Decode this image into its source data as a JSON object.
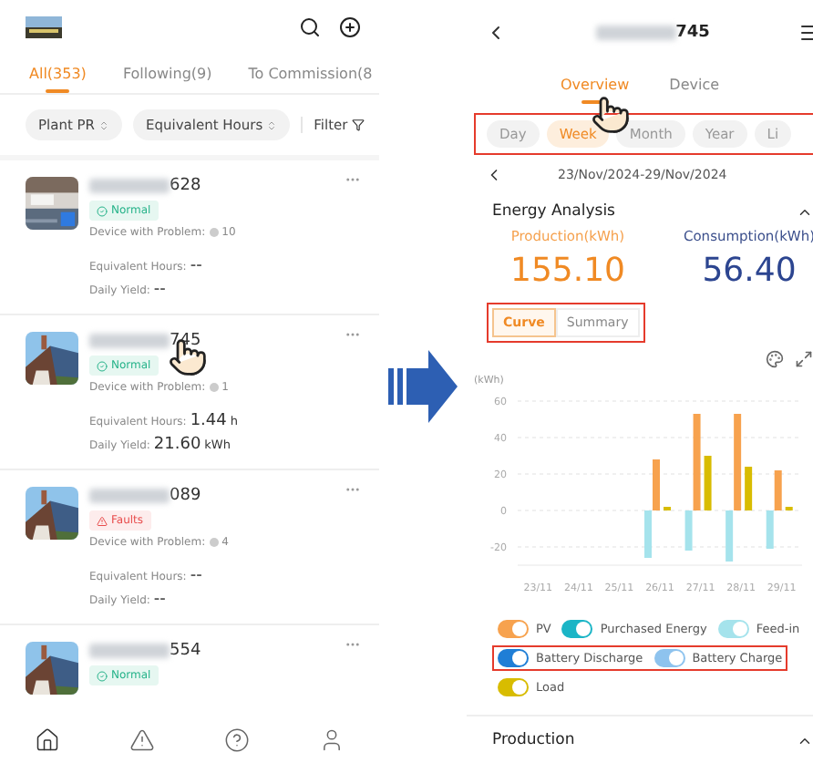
{
  "left_screen": {
    "tabs": [
      {
        "label": "All(353)",
        "selected": true
      },
      {
        "label": "Following(9)",
        "selected": false
      },
      {
        "label": "To Commission(8",
        "selected": false
      }
    ],
    "sort_chips": [
      {
        "label": "Plant PR"
      },
      {
        "label": "Equivalent Hours"
      }
    ],
    "filter": "Filter",
    "plants": [
      {
        "id_suffix": "628",
        "status": "Normal",
        "kind": "normal",
        "problem_label": "Device with Problem:",
        "problem_count": "10",
        "hours_label": "Equivalent Hours:",
        "hours_value": "--",
        "yield_label": "Daily Yield:",
        "yield_value": "--",
        "pointer": false
      },
      {
        "id_suffix": "745",
        "status": "Normal",
        "kind": "normal",
        "problem_label": "Device with Problem:",
        "problem_count": "1",
        "hours_label": "Equivalent Hours:",
        "hours_value": "1.44",
        "hours_unit": "h",
        "yield_label": "Daily Yield:",
        "yield_value": "21.60",
        "yield_unit": "kWh",
        "pointer": true
      },
      {
        "id_suffix": "089",
        "status": "Faults",
        "kind": "fault",
        "problem_label": "Device with Problem:",
        "problem_count": "4",
        "hours_label": "Equivalent Hours:",
        "hours_value": "--",
        "yield_label": "Daily Yield:",
        "yield_value": "--",
        "pointer": false
      },
      {
        "id_suffix": "554",
        "status": "Normal",
        "kind": "normal",
        "pointer": false
      }
    ]
  },
  "right_screen": {
    "title_suffix": "745",
    "tabs": [
      {
        "label": "Overview",
        "selected": true
      },
      {
        "label": "Device",
        "selected": false
      }
    ],
    "periods": {
      "highlighted": true,
      "items": [
        {
          "label": "Day",
          "selected": false
        },
        {
          "label": "Week",
          "selected": true
        },
        {
          "label": "Month",
          "selected": false
        },
        {
          "label": "Year",
          "selected": false
        },
        {
          "label": "Li",
          "selected": false
        }
      ]
    },
    "date_range": "23/Nov/2024-29/Nov/2024",
    "section_title": "Energy Analysis",
    "production_label": "Production(kWh)",
    "production_value": "155.10",
    "consumption_label": "Consumption(kWh)",
    "consumption_value": "56.40",
    "view_toggle": {
      "highlighted": true,
      "items": [
        {
          "label": "Curve",
          "selected": true
        },
        {
          "label": "Summary",
          "selected": false
        }
      ]
    },
    "legend": [
      {
        "on": true,
        "highlighted": false
      },
      {
        "on": true,
        "highlighted": false
      },
      {
        "on": true,
        "highlighted": false
      },
      {
        "on": true,
        "highlighted": true
      },
      {
        "on": true,
        "highlighted": true
      },
      {
        "on": true,
        "highlighted": false
      }
    ],
    "chart_data": {
      "type": "bar",
      "ylabel": "(kWh)",
      "grid": true,
      "ylim": [
        -30,
        60
      ],
      "categories": [
        "23/11",
        "24/11",
        "25/11",
        "26/11",
        "27/11",
        "28/11",
        "29/11"
      ],
      "yticks": [
        -20,
        0,
        20,
        40,
        60
      ],
      "series": [
        {
          "name": "PV",
          "color": "#f7a24e",
          "values": [
            null,
            null,
            null,
            28,
            53,
            53,
            22
          ]
        },
        {
          "name": "Purchased Energy",
          "color": "#1bb5c6",
          "values": [
            null,
            null,
            null,
            null,
            null,
            null,
            null
          ]
        },
        {
          "name": "Feed-in",
          "color": "#a5e3ec",
          "values": [
            null,
            null,
            null,
            -26,
            -22,
            -28,
            -21
          ]
        },
        {
          "name": "Battery Discharge",
          "color": "#1f7ed6",
          "values": [
            null,
            null,
            null,
            null,
            null,
            null,
            null
          ]
        },
        {
          "name": "Battery Charge",
          "color": "#8ec3ee",
          "values": [
            null,
            null,
            null,
            null,
            null,
            null,
            null
          ]
        },
        {
          "name": "Load",
          "color": "#d8bc00",
          "values": [
            null,
            null,
            null,
            2,
            30,
            24,
            2
          ]
        }
      ]
    },
    "next_section": "Production"
  }
}
